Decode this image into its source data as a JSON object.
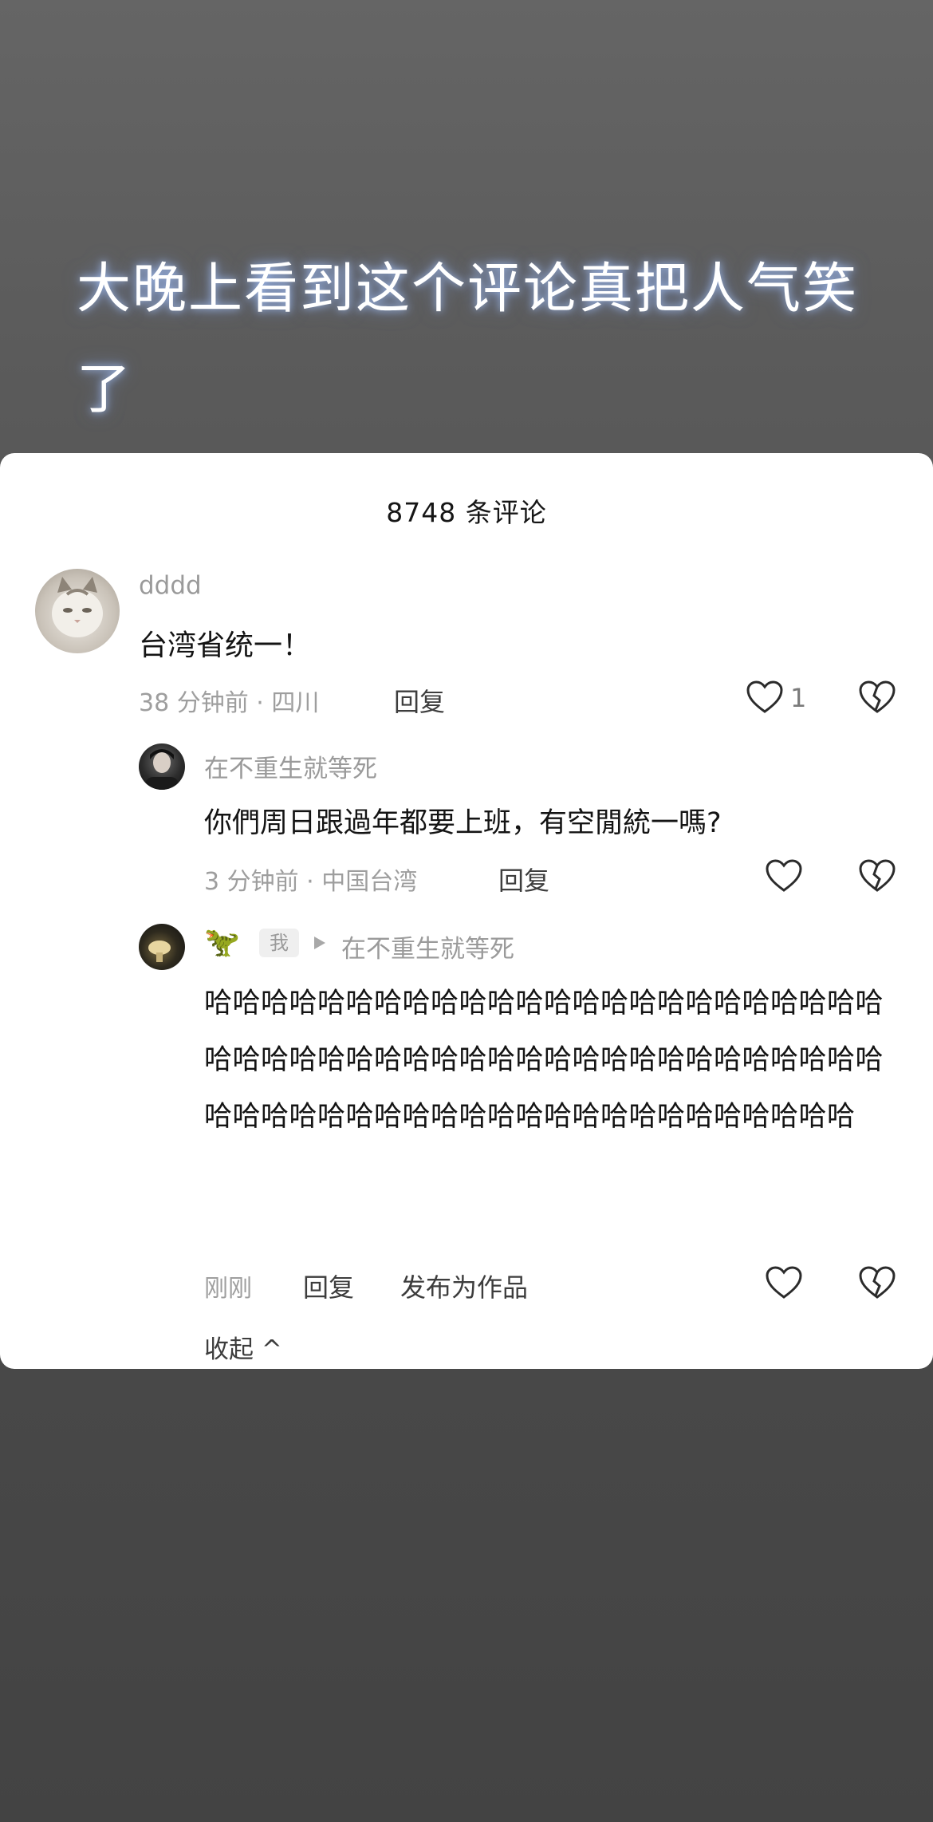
{
  "overlay_title": "大晚上看到这个评论真把人气笑了",
  "header": {
    "comment_count_label": "8748 条评论"
  },
  "comments": [
    {
      "username": "dddd",
      "avatar": "cat-avatar",
      "text": "台湾省统一！",
      "meta": "38 分钟前 · 四川",
      "reply_label": "回复",
      "like_count": "1",
      "replies": [
        {
          "username": "在不重生就等死",
          "text": "你們周日跟過年都要上班，有空閒統一嗎?",
          "meta": "3 分钟前 · 中国台湾",
          "reply_label": "回复"
        },
        {
          "username_emoji": "🦖",
          "author_badge": "我",
          "reply_to": "在不重生就等死",
          "text": "哈哈哈哈哈哈哈哈哈哈哈哈哈哈哈哈哈哈哈哈哈哈哈哈哈哈哈哈哈哈哈哈哈哈哈哈哈哈哈哈哈哈哈哈哈哈哈哈哈哈哈哈哈哈哈哈哈哈哈哈哈哈哈哈哈哈哈哈哈哈哈",
          "meta": "刚刚",
          "reply_label": "回复",
          "publish_label": "发布为作品"
        }
      ],
      "collapse_label": "收起 ^"
    }
  ],
  "icons": [
    "heart-icon",
    "dislike-icon",
    "caret-right-icon"
  ],
  "colors": {
    "muted": "#9e9e9e",
    "text": "#141414",
    "background_overlay": "#5c5c5c"
  }
}
